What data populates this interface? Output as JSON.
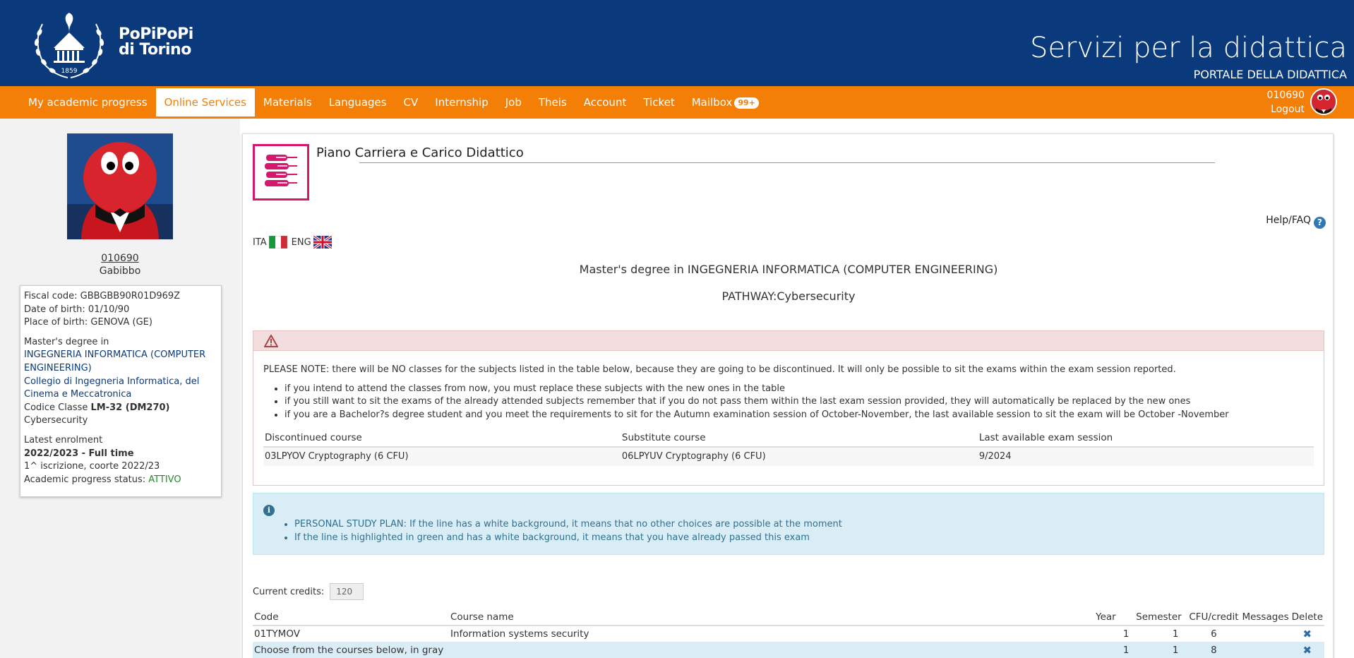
{
  "header": {
    "logo_line1": "PoPiPoPi",
    "logo_line2": "di Torino",
    "logo_year": "1859",
    "title": "Servizi per la didattica",
    "subtitle": "PORTALE DELLA DIDATTICA"
  },
  "nav": {
    "items": [
      {
        "label": "My academic progress"
      },
      {
        "label": "Online Services",
        "active": true
      },
      {
        "label": "Materials"
      },
      {
        "label": "Languages"
      },
      {
        "label": "CV"
      },
      {
        "label": "Internship"
      },
      {
        "label": "Job"
      },
      {
        "label": "Theis"
      },
      {
        "label": "Account"
      },
      {
        "label": "Ticket"
      },
      {
        "label": "Mailbox"
      }
    ],
    "mailbox_badge": "99+",
    "user_id": "010690",
    "logout": "Logout"
  },
  "profile": {
    "id": "010690",
    "name": "Gabibbo",
    "fiscal_code": "Fiscal code: GBBGBB90R01D969Z",
    "dob": "Date of birth: 01/10/90",
    "pob": "Place of birth: GENOVA (GE)",
    "degree_label": "Master's degree in",
    "degree_name": "INGEGNERIA INFORMATICA (COMPUTER ENGINEERING)",
    "college": "Collegio di Ingegneria Informatica, del Cinema e Meccatronica",
    "class_prefix": "Codice Classe ",
    "class_code": "LM-32 (DM270)",
    "pathway": "Cybersecurity",
    "enrol_label": "Latest enrolment",
    "enrol_value": "2022/2023 - Full time",
    "enrol_detail": "1^ iscrizione, coorte 2022/23",
    "status_label": "Academic progress status: ",
    "status_value": "ATTIVO"
  },
  "main": {
    "title": "Piano Carriera e Carico Didattico",
    "help": "Help/FAQ",
    "lang_ita": "ITA",
    "lang_eng": "ENG",
    "degree": "Master's degree in INGEGNERIA INFORMATICA (COMPUTER ENGINEERING)",
    "pathway": "PATHWAY:Cybersecurity",
    "warning": {
      "note": "PLEASE NOTE: there will be NO classes for the subjects listed in the table below, because they are going to be discontinued. It will only be possible to sit the exams within the exam session reported.",
      "bullets": [
        "if you intend to attend the classes from now, you must replace these subjects with the new ones in the table",
        "if you still want to sit the exams of the already attended subjects remember that if you do not pass them within the last exam session provided, they will automatically be replaced by the new ones",
        "if you are a Bachelor?s degree student and you meet the requirements to sit for the Autumn examination session of October-November, the last available session to sit the exam will be October -November"
      ],
      "headers": [
        "Discontinued course",
        "Substitute course",
        "Last available exam session"
      ],
      "row": [
        "03LPYOV Cryptography (6 CFU)",
        "06LPYUV Cryptography (6 CFU)",
        "9/2024"
      ]
    },
    "info": {
      "line1_strong": "PERSONAL STUDY PLAN:",
      "line1_rest": " If the line has a white background, it means that no other choices are possible at the moment",
      "line2": "If the line is highlighted in green and has a white background, it means that you have already passed this exam"
    },
    "credits_label": "Current credits:",
    "credits_value": "120",
    "plan": {
      "headers": [
        "Code",
        "Course name",
        "Year",
        "Semester",
        "CFU/credit",
        "Messages",
        "Delete"
      ],
      "rows": [
        {
          "code": "01TYMOV",
          "name": "Information systems security",
          "year": "1",
          "semester": "1",
          "cfu": "6"
        },
        {
          "code": "Choose from the courses below, in gray",
          "name": "",
          "year": "1",
          "semester": "1",
          "cfu": "8"
        }
      ]
    }
  }
}
